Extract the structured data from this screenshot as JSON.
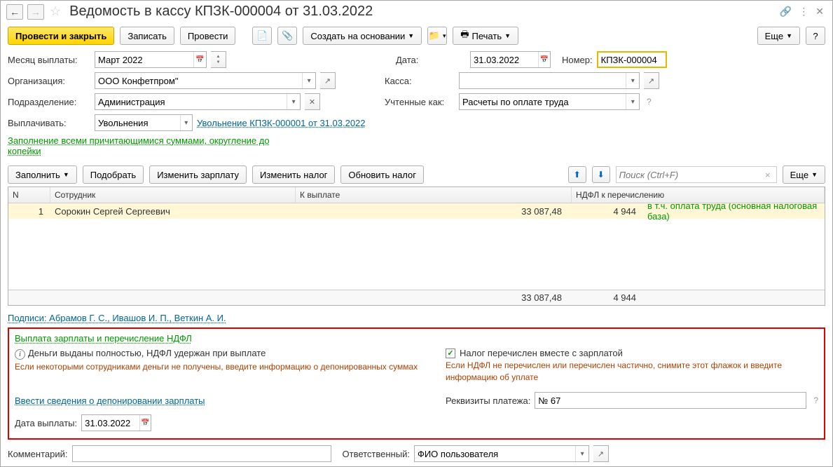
{
  "title": "Ведомость в кассу КПЗК-000004 от 31.03.2022",
  "toolbar": {
    "process_close": "Провести и закрыть",
    "save": "Записать",
    "process": "Провести",
    "create_based": "Создать на основании",
    "print": "Печать",
    "more": "Еще",
    "help": "?"
  },
  "form": {
    "month_label": "Месяц выплаты:",
    "month_value": "Март 2022",
    "date_label": "Дата:",
    "date_value": "31.03.2022",
    "number_label": "Номер:",
    "number_value": "КПЗК-000004",
    "org_label": "Организация:",
    "org_value": "ООО Конфетпром\"",
    "kassa_label": "Касса:",
    "dept_label": "Подразделение:",
    "dept_value": "Администрация",
    "accounted_label": "Учтенные как:",
    "accounted_value": "Расчеты по оплате труда",
    "pay_label": "Выплачивать:",
    "pay_value": "Увольнения",
    "pay_link": "Увольнение КПЗК-000001 от 31.03.2022",
    "fill_link": "Заполнение всеми причитающимися суммами, округление до копейки"
  },
  "table_toolbar": {
    "fill": "Заполнить",
    "pick": "Подобрать",
    "change_salary": "Изменить зарплату",
    "change_tax": "Изменить налог",
    "update_tax": "Обновить налог",
    "search_placeholder": "Поиск (Ctrl+F)",
    "more": "Еще"
  },
  "table": {
    "headers": {
      "n": "N",
      "emp": "Сотрудник",
      "pay": "К выплате",
      "ndfl": "НДФЛ к перечислению"
    },
    "rows": [
      {
        "n": "1",
        "emp": "Сорокин Сергей Сергеевич",
        "pay": "33 087,48",
        "ndfl": "4 944",
        "note": "в т.ч. оплата труда (основная налоговая база)"
      }
    ],
    "totals": {
      "pay": "33 087,48",
      "ndfl": "4 944"
    }
  },
  "signatures": "Подписи: Абрамов Г. С., Ивашов И. П., Веткин А. И.",
  "payout": {
    "header": "Выплата зарплаты и перечисление НДФЛ",
    "money_text": "Деньги выданы полностью, НДФЛ удержан при выплате",
    "money_warn": "Если некоторыми сотрудниками деньги не получены, введите информацию о депонированных суммах",
    "tax_check": "Налог перечислен вместе с зарплатой",
    "tax_warn": "Если НДФЛ не перечислен или перечислен частично, снимите этот флажок и введите информацию об уплате",
    "depo_link": "Ввести сведения о депонировании зарплаты",
    "req_label": "Реквизиты платежа:",
    "req_value": "№ 67",
    "paydate_label": "Дата выплаты:",
    "paydate_value": "31.03.2022"
  },
  "bottom": {
    "comment_label": "Комментарий:",
    "resp_label": "Ответственный:",
    "resp_value": "ФИО пользователя"
  }
}
